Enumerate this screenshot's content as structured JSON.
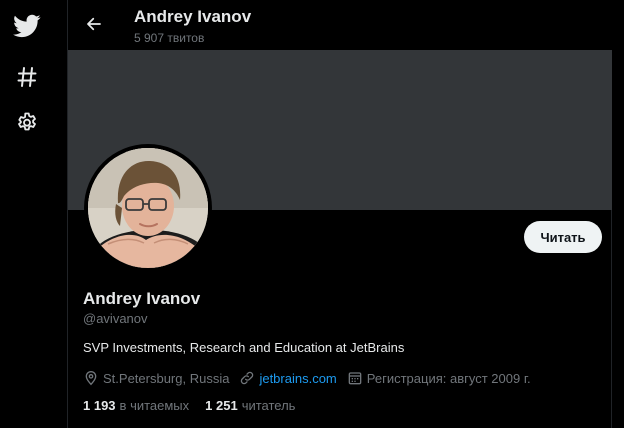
{
  "sidebar": {
    "items": [
      {
        "icon": "twitter-bird-icon",
        "name": "home"
      },
      {
        "icon": "hashtag-icon",
        "name": "explore"
      },
      {
        "icon": "gear-icon",
        "name": "settings"
      }
    ]
  },
  "header": {
    "back_icon": "back-arrow-icon",
    "title": "Andrey Ivanov",
    "subtitle": "5 907 твитов"
  },
  "profile": {
    "name": "Andrey Ivanov",
    "handle": "@avivanov",
    "bio": "SVP Investments, Research and Education at JetBrains",
    "location": "St.Petersburg, Russia",
    "website": "jetbrains.com",
    "joined": "Регистрация: август 2009 г.",
    "follow_label": "Читать",
    "following_count": "1 193",
    "following_label": "в читаемых",
    "followers_count": "1 251",
    "followers_label": "читатель"
  },
  "colors": {
    "background": "#000000",
    "banner": "#333639",
    "text_primary": "#e7e9ea",
    "text_secondary": "#71767b",
    "link": "#1d9bf0",
    "button_bg": "#eff3f4"
  }
}
